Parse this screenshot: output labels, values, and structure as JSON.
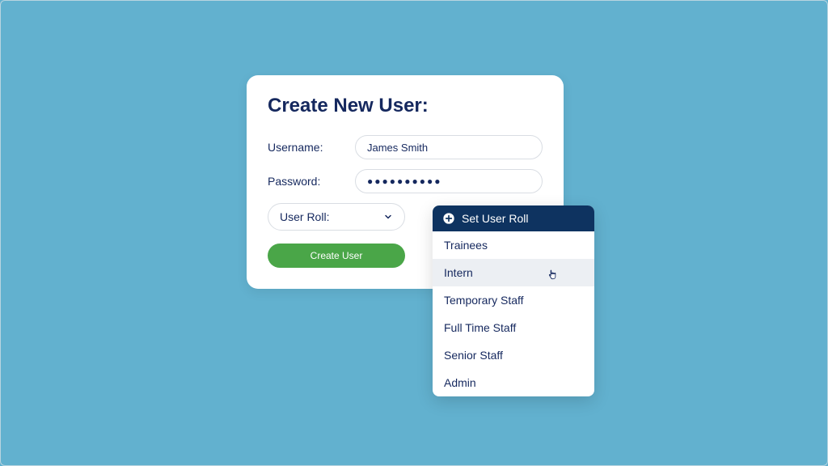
{
  "form": {
    "title": "Create New User:",
    "username_label": "Username:",
    "username_value": "James Smith",
    "password_label": "Password:",
    "password_value": "●●●●●●●●●●",
    "role_select_label": "User Roll:",
    "submit_label": "Create User"
  },
  "dropdown": {
    "header": "Set User Roll",
    "options": [
      "Trainees",
      "Intern",
      "Temporary Staff",
      "Full Time Staff",
      "Senior Staff",
      "Admin"
    ],
    "hovered_index": 1
  },
  "colors": {
    "background": "#62b1cf",
    "primary_dark": "#15285e",
    "header_navy": "#0e3360",
    "button_green": "#4aa648"
  }
}
